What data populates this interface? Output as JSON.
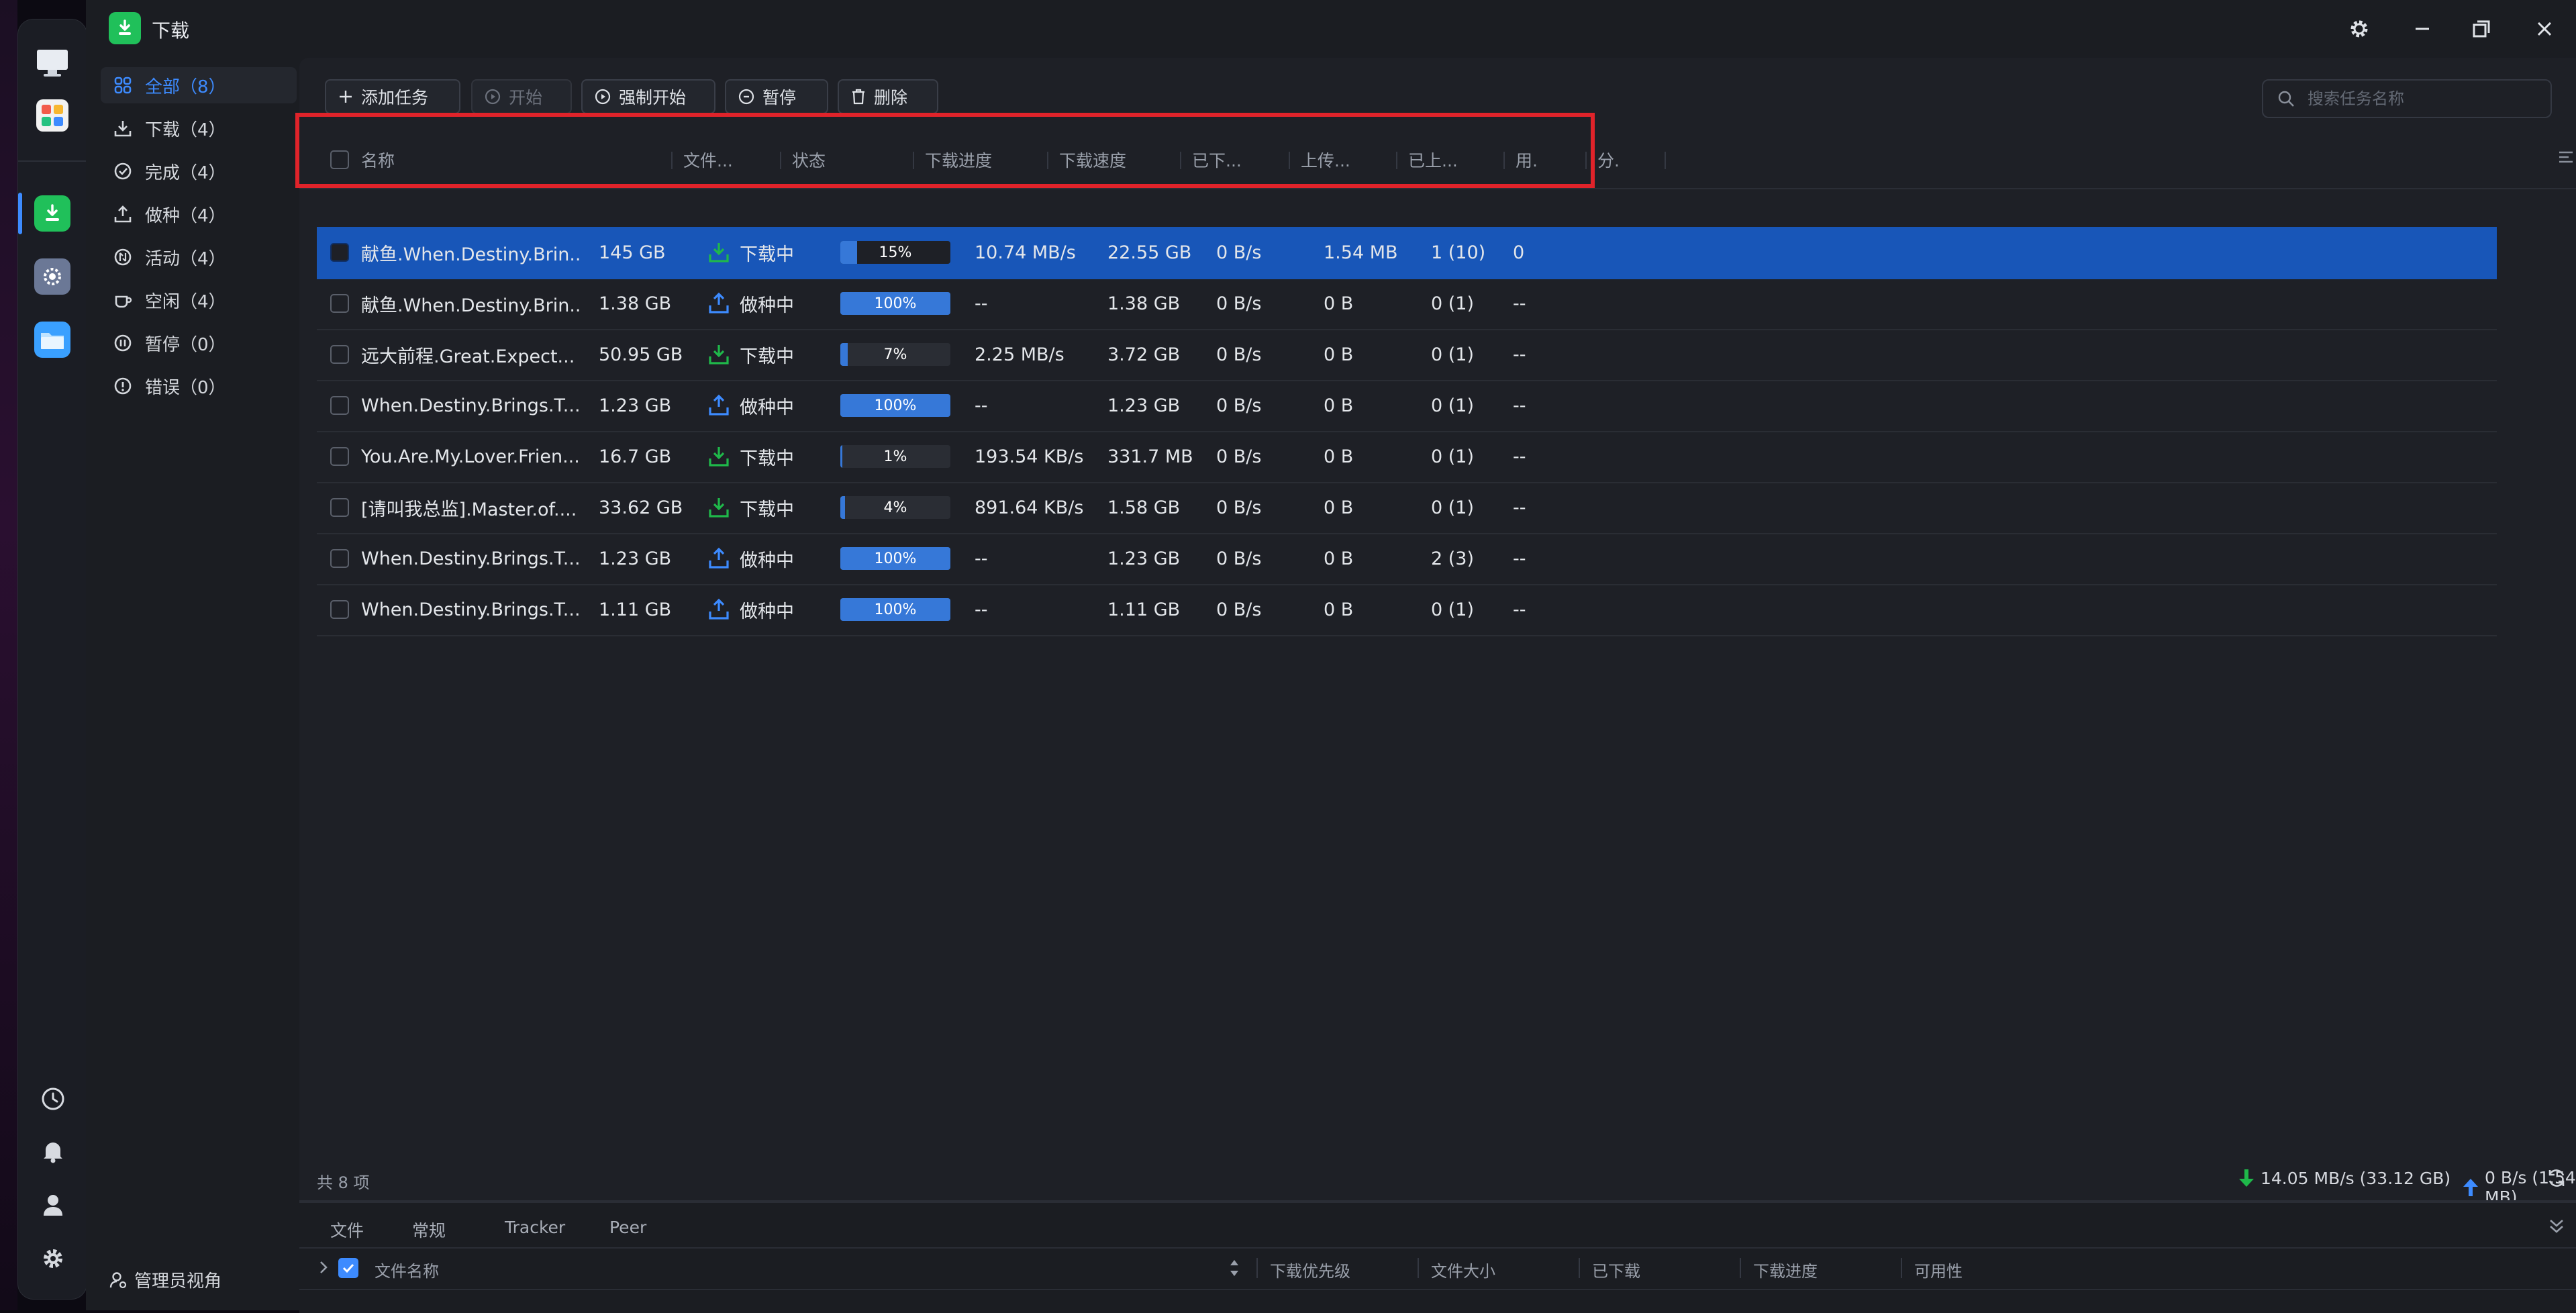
{
  "app": {
    "title": "下载"
  },
  "sidebar": {
    "items": [
      {
        "label": "全部（8）",
        "icon": "grid-icon"
      },
      {
        "label": "下载（4）",
        "icon": "download-icon"
      },
      {
        "label": "完成（4）",
        "icon": "check-circle-icon"
      },
      {
        "label": "做种（4）",
        "icon": "upload-icon"
      },
      {
        "label": "活动（4）",
        "icon": "activity-icon"
      },
      {
        "label": "空闲（4）",
        "icon": "cup-icon"
      },
      {
        "label": "暂停（0）",
        "icon": "pause-circle-icon"
      },
      {
        "label": "错误（0）",
        "icon": "error-circle-icon"
      }
    ],
    "admin_label": "管理员视角"
  },
  "toolbar": {
    "add_label": "添加任务",
    "start_label": "开始",
    "force_start_label": "强制开始",
    "pause_label": "暂停",
    "delete_label": "删除",
    "search_placeholder": "搜索任务名称"
  },
  "table": {
    "columns": [
      "名称",
      "文件...",
      "状态",
      "下载进度",
      "下载速度",
      "已下...",
      "上传...",
      "已上...",
      "用.",
      "分."
    ],
    "rows": [
      {
        "name": "献鱼.When.Destiny.Brin...",
        "size": "145 GB",
        "status": "下载中",
        "kind": "download",
        "progress": 15,
        "progress_label": "15%",
        "down_speed": "10.74 MB/s",
        "downloaded": "22.55 GB",
        "up_speed": "0 B/s",
        "uploaded": "1.54 MB",
        "users": "1 (10)",
        "share": "0",
        "selected": true
      },
      {
        "name": "献鱼.When.Destiny.Brin...",
        "size": "1.38 GB",
        "status": "做种中",
        "kind": "seed",
        "progress": 100,
        "progress_label": "100%",
        "down_speed": "--",
        "downloaded": "1.38 GB",
        "up_speed": "0 B/s",
        "uploaded": "0 B",
        "users": "0 (1)",
        "share": "--",
        "selected": false
      },
      {
        "name": "远大前程.Great.Expect...",
        "size": "50.95 GB",
        "status": "下载中",
        "kind": "download",
        "progress": 7,
        "progress_label": "7%",
        "down_speed": "2.25 MB/s",
        "downloaded": "3.72 GB",
        "up_speed": "0 B/s",
        "uploaded": "0 B",
        "users": "0 (1)",
        "share": "--",
        "selected": false
      },
      {
        "name": "When.Destiny.Brings.T...",
        "size": "1.23 GB",
        "status": "做种中",
        "kind": "seed",
        "progress": 100,
        "progress_label": "100%",
        "down_speed": "--",
        "downloaded": "1.23 GB",
        "up_speed": "0 B/s",
        "uploaded": "0 B",
        "users": "0 (1)",
        "share": "--",
        "selected": false
      },
      {
        "name": "You.Are.My.Lover.Frien...",
        "size": "16.7 GB",
        "status": "下载中",
        "kind": "download",
        "progress": 1,
        "progress_label": "1%",
        "down_speed": "193.54 KB/s",
        "downloaded": "331.7 MB",
        "up_speed": "0 B/s",
        "uploaded": "0 B",
        "users": "0 (1)",
        "share": "--",
        "selected": false
      },
      {
        "name": "[请叫我总监].Master.of....",
        "size": "33.62 GB",
        "status": "下载中",
        "kind": "download",
        "progress": 4,
        "progress_label": "4%",
        "down_speed": "891.64 KB/s",
        "downloaded": "1.58 GB",
        "up_speed": "0 B/s",
        "uploaded": "0 B",
        "users": "0 (1)",
        "share": "--",
        "selected": false
      },
      {
        "name": "When.Destiny.Brings.T...",
        "size": "1.23 GB",
        "status": "做种中",
        "kind": "seed",
        "progress": 100,
        "progress_label": "100%",
        "down_speed": "--",
        "downloaded": "1.23 GB",
        "up_speed": "0 B/s",
        "uploaded": "0 B",
        "users": "2 (3)",
        "share": "--",
        "selected": false
      },
      {
        "name": "When.Destiny.Brings.T...",
        "size": "1.11 GB",
        "status": "做种中",
        "kind": "seed",
        "progress": 100,
        "progress_label": "100%",
        "down_speed": "--",
        "downloaded": "1.11 GB",
        "up_speed": "0 B/s",
        "uploaded": "0 B",
        "users": "0 (1)",
        "share": "--",
        "selected": false
      }
    ]
  },
  "statusbar": {
    "total": "共 8 项",
    "download_total": "14.05 MB/s (33.12 GB)",
    "upload_total": "0 B/s (1.54 MB)"
  },
  "bottom_panel": {
    "tabs": [
      "文件",
      "常规",
      "Tracker",
      "Peer"
    ],
    "columns": [
      "文件名称",
      "下载优先级",
      "文件大小",
      "已下载",
      "下载进度",
      "可用性"
    ]
  },
  "colors": {
    "accent": "#3d8bff",
    "selected_row": "#1856b8",
    "progress": "#3678d8",
    "download_icon": "#1fb84a",
    "seed_icon": "#3d8bff",
    "highlight_box": "#e0232a"
  }
}
